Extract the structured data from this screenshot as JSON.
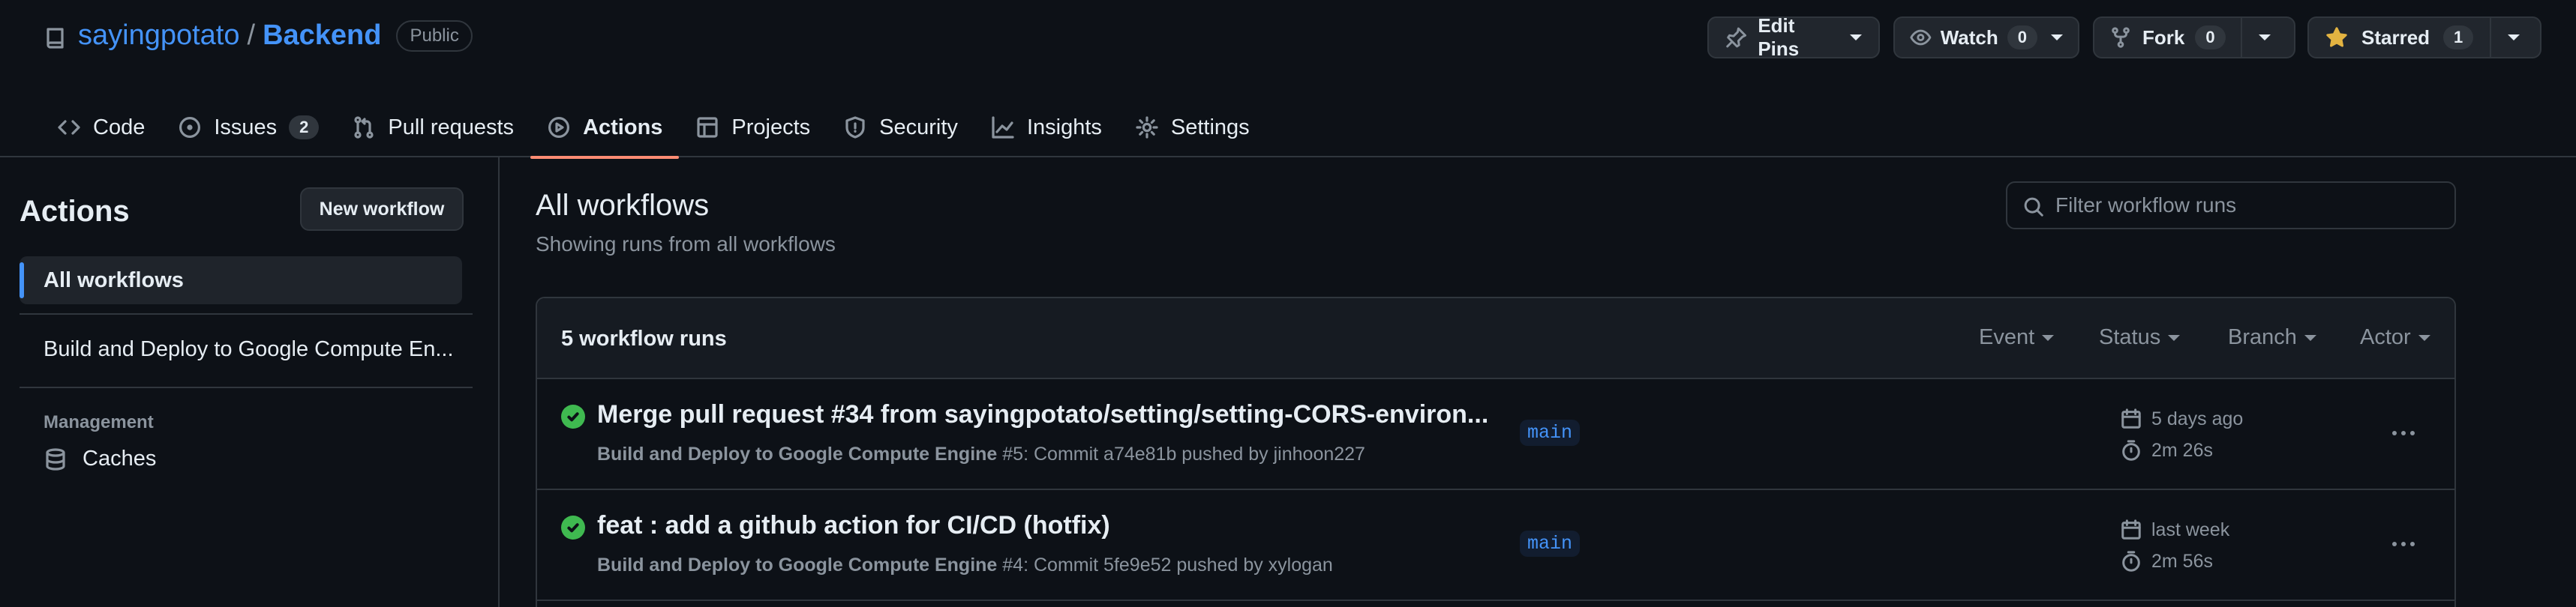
{
  "repo": {
    "owner": "sayingpotato",
    "separator": "/",
    "name": "Backend",
    "visibility": "Public"
  },
  "header_actions": {
    "edit_pins": {
      "label": "Edit Pins",
      "icon": "pin-icon"
    },
    "watch": {
      "label": "Watch",
      "count": "0",
      "icon": "eye-icon"
    },
    "fork": {
      "label": "Fork",
      "count": "0",
      "icon": "fork-icon"
    },
    "star": {
      "label": "Starred",
      "count": "1",
      "icon": "star-filled-icon",
      "icon_color": "#e3b341"
    }
  },
  "tabs": [
    {
      "label": "Code",
      "icon": "code-icon"
    },
    {
      "label": "Issues",
      "count": "2",
      "icon": "issue-icon"
    },
    {
      "label": "Pull requests",
      "icon": "pull-request-icon"
    },
    {
      "label": "Actions",
      "icon": "play-icon",
      "active": true
    },
    {
      "label": "Projects",
      "icon": "table-icon"
    },
    {
      "label": "Security",
      "icon": "shield-icon"
    },
    {
      "label": "Insights",
      "icon": "graph-icon"
    },
    {
      "label": "Settings",
      "icon": "gear-icon"
    }
  ],
  "sidebar": {
    "title": "Actions",
    "new_workflow_label": "New workflow",
    "all_workflows_label": "All workflows",
    "workflows": [
      {
        "label": "Build and Deploy to Google Compute En..."
      }
    ],
    "management_heading": "Management",
    "caches_label": "Caches"
  },
  "main": {
    "title": "All workflows",
    "subtitle": "Showing runs from all workflows",
    "filter_placeholder": "Filter workflow runs",
    "runs_count": "5 workflow runs",
    "filters": [
      "Event",
      "Status",
      "Branch",
      "Actor"
    ],
    "runs": [
      {
        "title": "Merge pull request #34 from sayingpotato/setting/setting-CORS-environ...",
        "workflow": "Build and Deploy to Google Compute Engine",
        "run_number": "#5",
        "description": ": Commit a74e81b pushed by jinhoon227",
        "branch": "main",
        "date": "5 days ago",
        "duration": "2m 26s",
        "status": "success"
      },
      {
        "title": "feat : add a github action for CI/CD (hotfix)",
        "workflow": "Build and Deploy to Google Compute Engine",
        "run_number": "#4",
        "description": ": Commit 5fe9e52 pushed by xylogan",
        "branch": "main",
        "date": "last week",
        "duration": "2m 56s",
        "status": "success"
      }
    ]
  },
  "colors": {
    "background": "#0d1117",
    "accent_link": "#4493f8",
    "active_tab_underline": "#fd8c73",
    "success": "#3fb950",
    "muted_text": "#8b949e",
    "border": "#30363d"
  }
}
